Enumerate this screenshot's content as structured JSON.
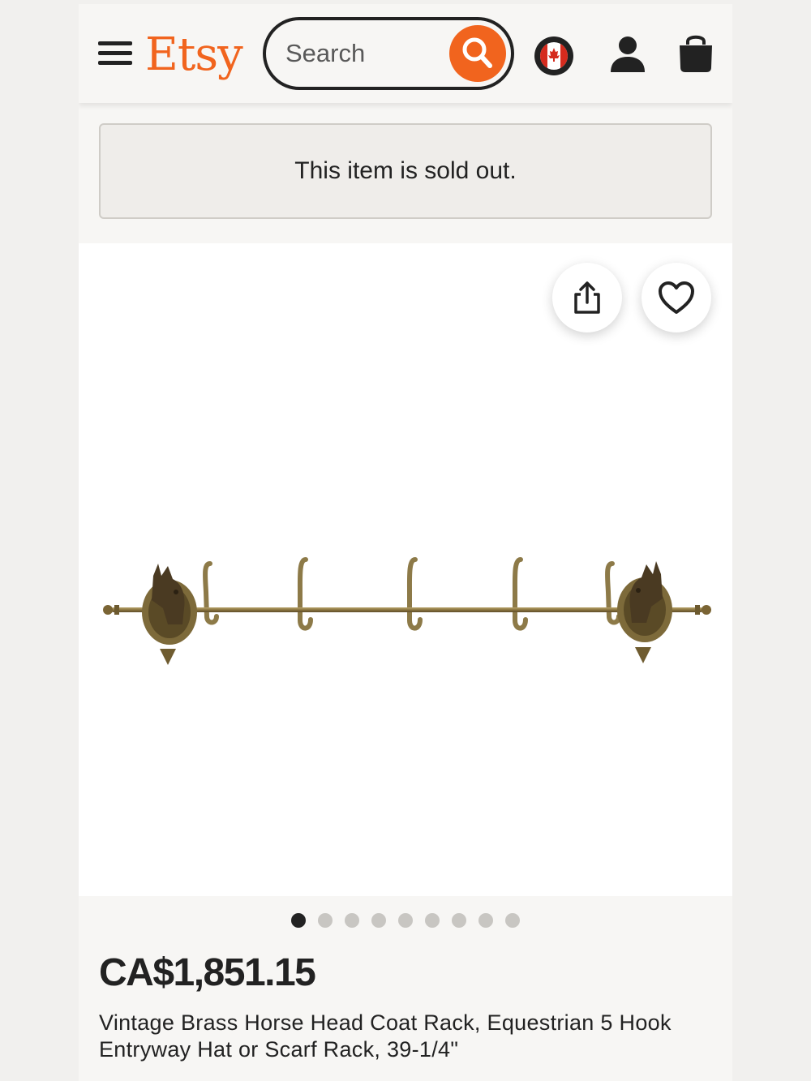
{
  "header": {
    "logo_text": "Etsy",
    "search_placeholder": "Search",
    "region_flag": "canada-flag-icon",
    "accent_color": "#f1641e"
  },
  "notice": {
    "sold_out_text": "This item is sold out."
  },
  "gallery": {
    "image_count": 9,
    "active_index": 0,
    "image_subject": "brass-horse-head-coat-rack"
  },
  "listing": {
    "price": "CA$1,851.15",
    "title": "Vintage Brass Horse Head Coat Rack, Equestrian 5 Hook Entryway Hat or Scarf Rack, 39-1/4\""
  }
}
